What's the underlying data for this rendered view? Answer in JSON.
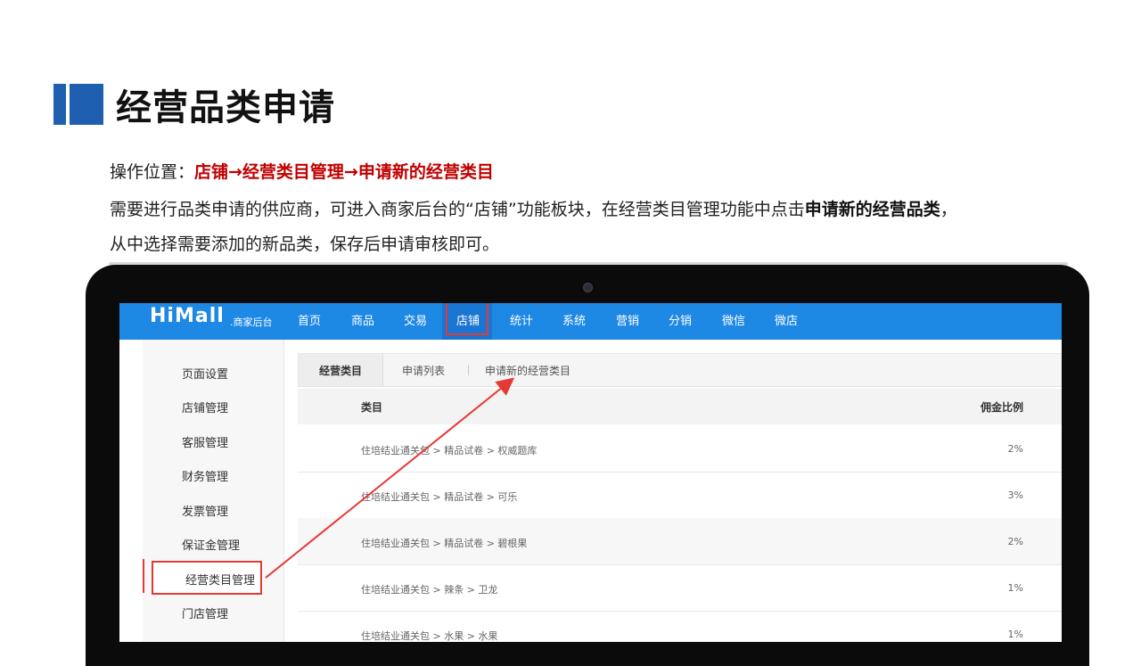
{
  "slide": {
    "title": "经营品类申请",
    "location_prefix": "操作位置：",
    "location_path": "店铺→经营类目管理→申请新的经营类目",
    "desc_part1": "需要进行品类申请的供应商，可进入商家后台的“店铺”功能板块，在经营类目管理功能中点击",
    "desc_bold": "申请新的经营品类",
    "desc_part2": "，",
    "desc_line2": "从中选择需要添加的新品类，保存后申请审核即可。"
  },
  "app": {
    "logo": "HiMall",
    "logo_sub": ".商家后台",
    "nav": [
      "首页",
      "商品",
      "交易",
      "店铺",
      "统计",
      "系统",
      "营销",
      "分销",
      "微信",
      "微店"
    ],
    "active_nav": "店铺"
  },
  "sidebar": {
    "items": [
      "页面设置",
      "店铺管理",
      "客服管理",
      "财务管理",
      "发票管理",
      "保证金管理",
      "经营类目管理",
      "门店管理"
    ],
    "active": "经营类目管理"
  },
  "tabs": [
    "经营类目",
    "申请列表",
    "申请新的经营类目"
  ],
  "table": {
    "headers": [
      "类目",
      "佣金比例"
    ],
    "rows": [
      {
        "category": "住培结业通关包 > 精品试卷 > 权威题库",
        "rate": "2%"
      },
      {
        "category": "住培结业通关包 > 精品试卷 > 可乐",
        "rate": "3%"
      },
      {
        "category": "住培结业通关包 > 精品试卷 > 碧根果",
        "rate": "2%"
      },
      {
        "category": "住培结业通关包 > 辣条 > 卫龙",
        "rate": "1%"
      },
      {
        "category": "住培结业通关包 > 水果 > 水果",
        "rate": "1%"
      }
    ]
  },
  "colors": {
    "accent_blue": "#1e88e5",
    "title_block": "#1f5fb0",
    "highlight_red": "#e53935",
    "text_red": "#c00000"
  }
}
